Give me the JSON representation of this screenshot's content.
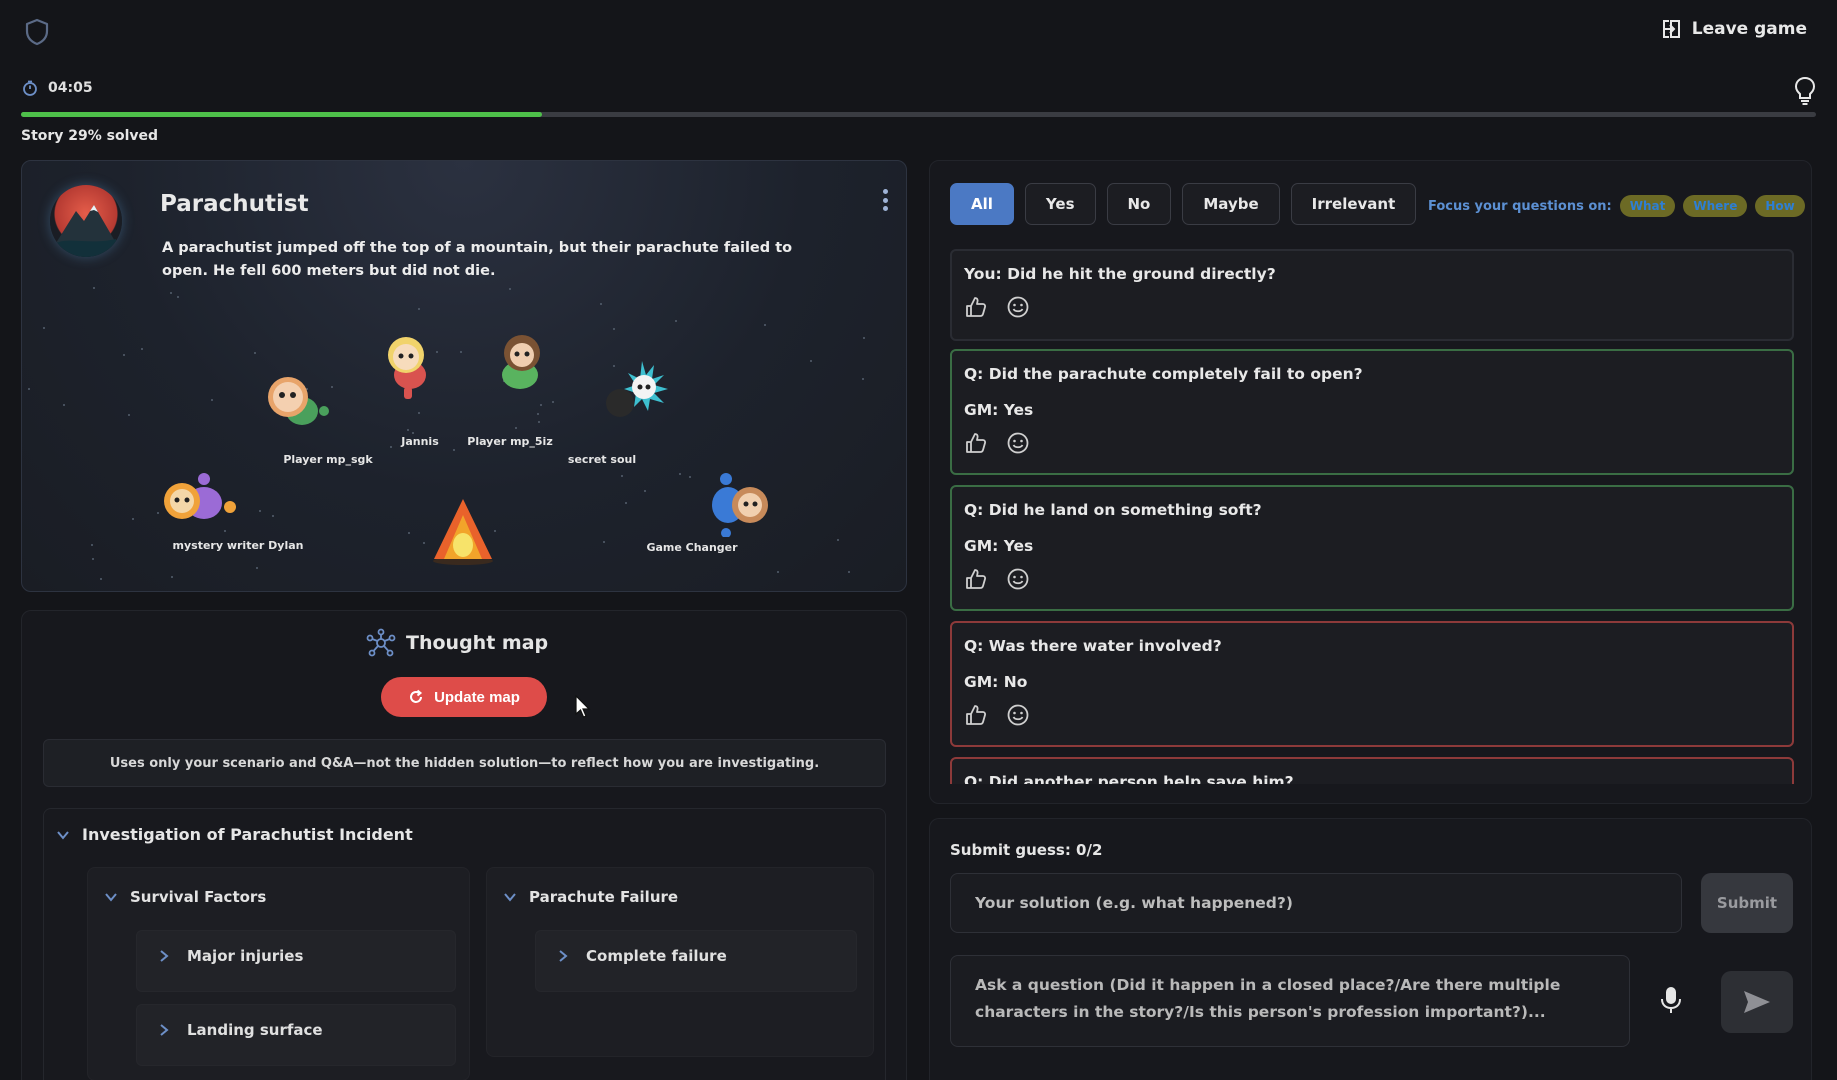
{
  "header": {
    "leave_label": "Leave game",
    "timer": "04:05"
  },
  "progress": {
    "fraction": 0.29,
    "label": "Story 29% solved"
  },
  "story": {
    "title": "Parachutist",
    "text": "A parachutist jumped off the top of a mountain, but their parachute failed to open. He fell 600 meters but did not die.",
    "players": [
      {
        "name": "Player mp_sgk",
        "color": "#e8a46a",
        "accent": "#4aa05c"
      },
      {
        "name": "Jannis",
        "color": "#f1d36b",
        "accent": "#d9534f"
      },
      {
        "name": "Player mp_5iz",
        "color": "#7a5233",
        "accent": "#59b35f"
      },
      {
        "name": "secret soul",
        "color": "#3ec0d0",
        "accent": "#2a2a2a"
      },
      {
        "name": "mystery writer Dylan",
        "color": "#9b6bd6",
        "accent": "#f0a23a"
      },
      {
        "name": "Game Changer",
        "color": "#3a7ad6",
        "accent": "#c78a5a"
      }
    ]
  },
  "thought_map": {
    "title": "Thought map",
    "update_label": "Update map",
    "note": "Uses only your scenario and Q&A—not the hidden solution—to reflect how you are investigating.",
    "root": "Investigation of Parachutist Incident",
    "branches": [
      {
        "title": "Survival Factors",
        "leaves": [
          "Major injuries",
          "Landing surface"
        ]
      },
      {
        "title": "Parachute Failure",
        "leaves": [
          "Complete failure"
        ]
      }
    ]
  },
  "qa": {
    "filters": [
      "All",
      "Yes",
      "No",
      "Maybe",
      "Irrelevant"
    ],
    "active_filter": "All",
    "focus_label": "Focus your questions on:",
    "focus_chips": [
      "What",
      "Where",
      "How"
    ],
    "items": [
      {
        "q": "You: Did he hit the ground directly?",
        "a": "",
        "kind": "pending"
      },
      {
        "q": "Q: Did the parachute completely fail to open?",
        "a": "GM: Yes",
        "kind": "yes"
      },
      {
        "q": "Q: Did he land on something soft?",
        "a": "GM: Yes",
        "kind": "yes"
      },
      {
        "q": "Q: Was there water involved?",
        "a": "GM: No",
        "kind": "no"
      },
      {
        "q": "Q: Did another person help save him?",
        "a": "",
        "kind": "no"
      }
    ]
  },
  "guess": {
    "label": "Submit guess: 0/2",
    "placeholder": "Your solution (e.g. what happened?)",
    "submit_label": "Submit",
    "ask_placeholder": "Ask a question (Did it happen in a closed place?/Are there multiple characters in the story?/Is this person's profession important?)..."
  },
  "colors": {
    "accent": "#4b79c4",
    "progress": "#4ec04a",
    "update_button": "#de4c49",
    "yes_border": "#3a6d44",
    "no_border": "#8d3a3a"
  }
}
